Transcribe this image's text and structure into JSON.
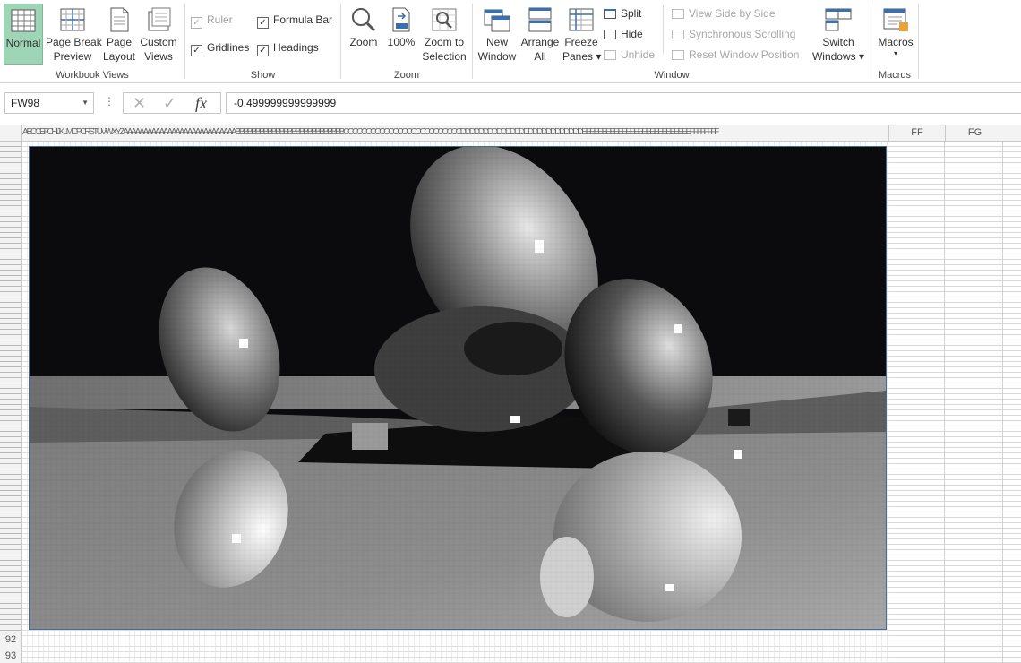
{
  "ribbon": {
    "workbook_views": {
      "label": "Workbook Views",
      "normal": [
        "Normal"
      ],
      "page_break": [
        "Page Break",
        "Preview"
      ],
      "page_layout": [
        "Page",
        "Layout"
      ],
      "custom_views": [
        "Custom",
        "Views"
      ]
    },
    "show": {
      "label": "Show",
      "ruler": "Ruler",
      "formula_bar": "Formula Bar",
      "gridlines": "Gridlines",
      "headings": "Headings"
    },
    "zoom": {
      "label": "Zoom",
      "zoom": [
        "Zoom"
      ],
      "hundred": [
        "100%"
      ],
      "zoom_selection": [
        "Zoom to",
        "Selection"
      ]
    },
    "window": {
      "label": "Window",
      "new_window": [
        "New",
        "Window"
      ],
      "arrange_all": [
        "Arrange",
        "All"
      ],
      "freeze_panes": [
        "Freeze",
        "Panes ▾"
      ],
      "split": "Split",
      "hide": "Hide",
      "unhide": "Unhide",
      "view_side": "View Side by Side",
      "sync_scroll": "Synchronous Scrolling",
      "reset_pos": "Reset Window Position",
      "switch_windows": [
        "Switch",
        "Windows ▾"
      ]
    },
    "macros": {
      "label": "Macros",
      "macros": [
        "Macros",
        "▾"
      ]
    }
  },
  "formula_bar": {
    "name_box": "FW98",
    "cancel_glyph": "✕",
    "enter_glyph": "✓",
    "fx_glyph": "fx",
    "value": "-0.499999999999999"
  },
  "grid": {
    "tiny_col_headers": "AECCEFCHIJKLMCPCRSTUVWXYZAAAAAAAAAAAAAAAAAAAAAAAAAAAABBBBBBBBBBBBBBBBBBBBBBBBBBBCCCCCCCCCCCCCCCCCCCCCCCCCCDDDDDDDDDDDDDDDDDDDDDDDDDDDEEEEEEEEEEEEEEEEEEEEEEEEEEEFFFFFFFF",
    "col_ff": "FF",
    "col_fg": "FG",
    "row_92": "92",
    "row_93": "93"
  },
  "colors": {
    "active_view": "#9fd5b7",
    "picture_border": "#3d6b9c"
  }
}
